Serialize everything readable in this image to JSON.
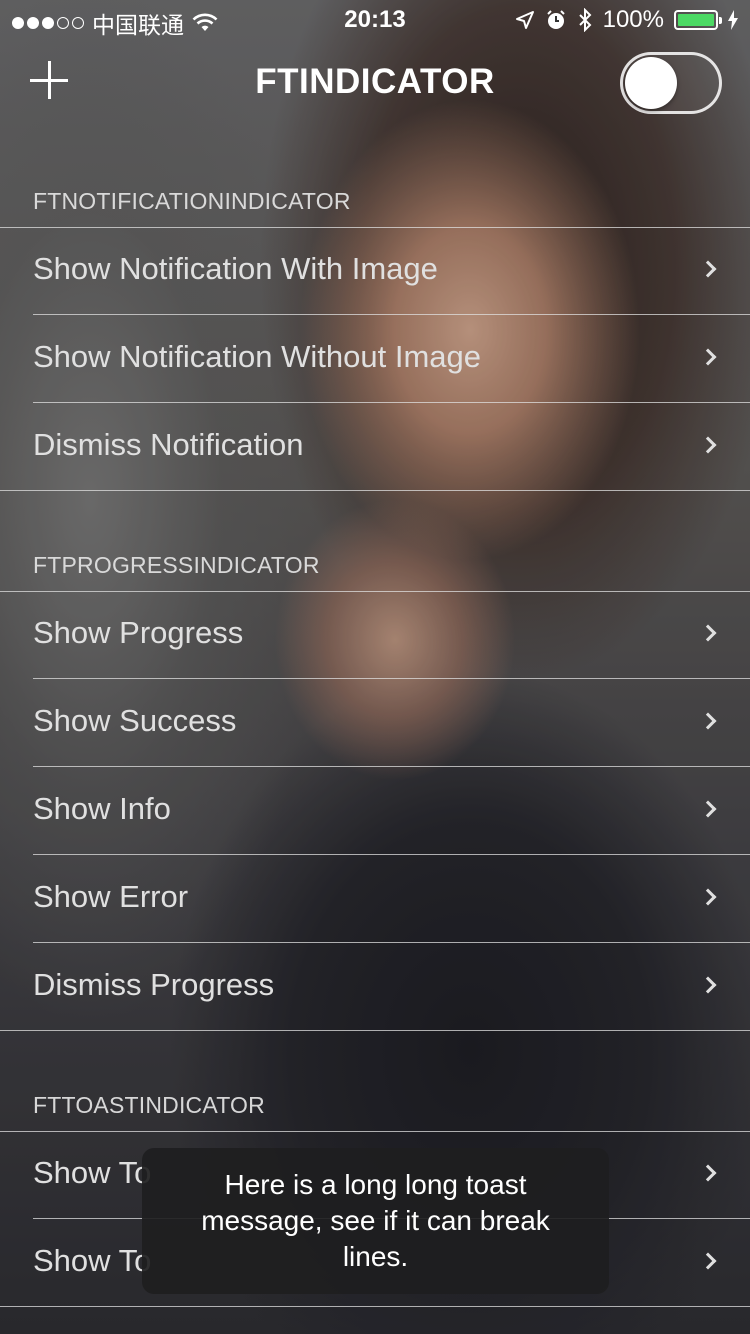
{
  "status_bar": {
    "carrier": "中国联通",
    "time": "20:13",
    "battery_text": "100%",
    "signal_bars_filled": 3,
    "signal_bars_total": 5,
    "battery_level": 1.0,
    "battery_color": "#4cd964"
  },
  "nav": {
    "add_icon": "plus-icon",
    "title": "FTINDICATOR",
    "toggle_on": false
  },
  "sections": [
    {
      "header": "FTNOTIFICATIONINDICATOR",
      "rows": [
        {
          "label": "Show Notification With Image"
        },
        {
          "label": "Show Notification Without Image"
        },
        {
          "label": "Dismiss Notification"
        }
      ]
    },
    {
      "header": "FTPROGRESSINDICATOR",
      "rows": [
        {
          "label": "Show Progress"
        },
        {
          "label": "Show Success"
        },
        {
          "label": "Show Info"
        },
        {
          "label": "Show Error"
        },
        {
          "label": "Dismiss Progress"
        }
      ]
    },
    {
      "header": "FTTOASTINDICATOR",
      "rows": [
        {
          "label": "Show To"
        },
        {
          "label": "Show To"
        }
      ]
    }
  ],
  "toast": {
    "message": "Here is a long long toast message, see if it can break lines."
  }
}
